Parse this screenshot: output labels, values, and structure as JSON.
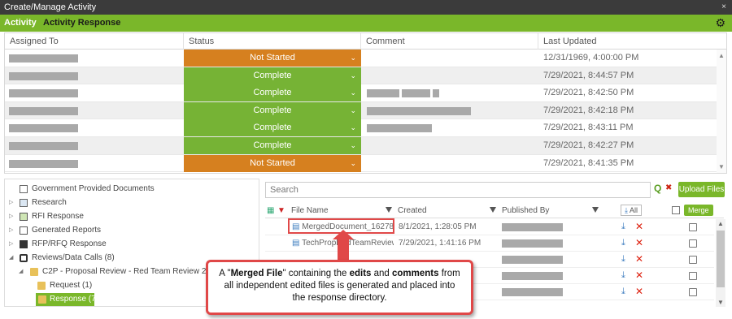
{
  "window": {
    "title": "Create/Manage Activity",
    "close_glyph": "×"
  },
  "tabs": [
    {
      "label": "Activity"
    },
    {
      "label": "Activity Response"
    }
  ],
  "grid": {
    "headers": [
      "Assigned To",
      "Status",
      "Comment",
      "Last Updated"
    ],
    "rows": [
      {
        "status": "Not Started",
        "updated": "12/31/1969, 4:00:00 PM"
      },
      {
        "status": "Complete",
        "updated": "7/29/2021, 8:44:57 PM"
      },
      {
        "status": "Complete",
        "updated": "7/29/2021, 8:42:50 PM"
      },
      {
        "status": "Complete",
        "updated": "7/29/2021, 8:42:18 PM"
      },
      {
        "status": "Complete",
        "updated": "7/29/2021, 8:43:11 PM"
      },
      {
        "status": "Complete",
        "updated": "7/29/2021, 8:42:27 PM"
      },
      {
        "status": "Not Started",
        "updated": "7/29/2021, 8:41:35 PM"
      }
    ]
  },
  "tree": {
    "items": [
      {
        "label": "Government Provided Documents"
      },
      {
        "label": "Research"
      },
      {
        "label": "RFI Response"
      },
      {
        "label": "Generated Reports"
      },
      {
        "label": "RFP/RFQ Response"
      },
      {
        "label": "Reviews/Data Calls (8)"
      },
      {
        "label": "C2P - Proposal Review - Red Team Review 2"
      },
      {
        "label": "Request (1)"
      },
      {
        "label": "Response (7)"
      }
    ]
  },
  "files": {
    "search_placeholder": "Search",
    "upload_label": "Upload Files",
    "headers": {
      "name": "File Name",
      "created": "Created",
      "published": "Published By",
      "all": "All",
      "merge": "Merge"
    },
    "rows": [
      {
        "name": "MergedDocument_162784...",
        "created": "8/1/2021, 1:28:05 PM"
      },
      {
        "name": "TechPropRedTeamReview...",
        "created": "7/29/2021, 1:41:16 PM"
      },
      {
        "name": "",
        "created": ""
      },
      {
        "name": "",
        "created": ""
      },
      {
        "name": "",
        "created": ""
      }
    ]
  },
  "callout": {
    "prefix": "A \"",
    "strong1": "Merged File",
    "mid1": "\" containing the ",
    "strong2": "edits",
    "mid2": " and ",
    "strong3": "comments",
    "rest": " from all independent edited files is generated and placed into the response directory."
  },
  "colors": {
    "accent_green": "#7ab72a",
    "status_orange": "#d6801f",
    "status_green": "#76b335",
    "callout_red": "#e04848"
  }
}
